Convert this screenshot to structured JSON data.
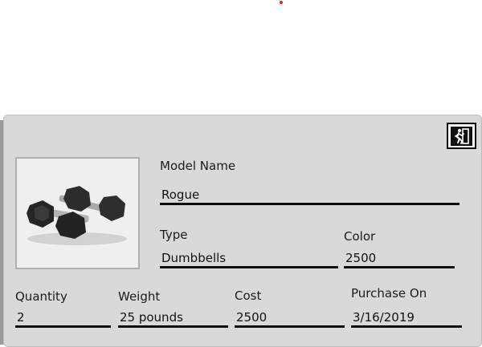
{
  "accent_colors": {
    "dot": "#e02424",
    "panel": "#d9d9d9",
    "underline": "#0d0d0d"
  },
  "header": {
    "exit_icon": "exit-running-man-icon"
  },
  "product": {
    "image_icon": "dumbbells-image"
  },
  "fields": {
    "model_name": {
      "label": "Model Name",
      "value": "Rogue"
    },
    "type": {
      "label": "Type",
      "value": "Dumbbells"
    },
    "color": {
      "label": "Color",
      "value": "2500"
    },
    "quantity": {
      "label": "Quantity",
      "value": "2"
    },
    "weight": {
      "label": "Weight",
      "value": "25 pounds"
    },
    "cost": {
      "label": "Cost",
      "value": "2500"
    },
    "purchase_on": {
      "label": "Purchase On",
      "value": "3/16/2019"
    }
  }
}
